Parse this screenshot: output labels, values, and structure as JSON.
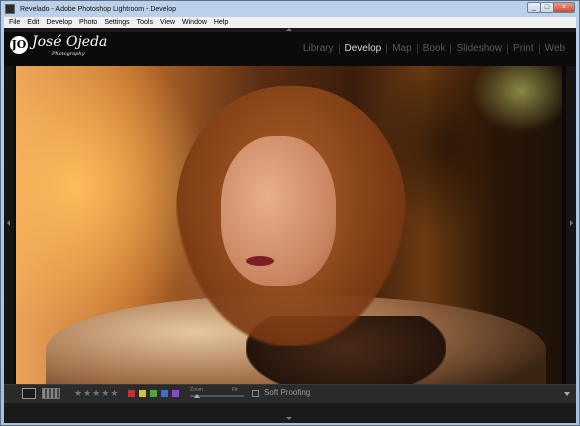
{
  "window": {
    "title": "Revelado - Adobe Photoshop Lightroom - Develop",
    "buttons": [
      "_",
      "□",
      "×"
    ]
  },
  "menu": [
    "File",
    "Edit",
    "Develop",
    "Photo",
    "Settings",
    "Tools",
    "View",
    "Window",
    "Help"
  ],
  "identity": {
    "badge": "JO",
    "name": "José Ojeda",
    "subtitle": "Photography"
  },
  "modules": {
    "items": [
      "Library",
      "Develop",
      "Map",
      "Book",
      "Slideshow",
      "Print",
      "Web"
    ],
    "active": "Develop"
  },
  "toolbar": {
    "stars_glyph": "★",
    "zoom_label": "Zoom",
    "fit_label": "Fit",
    "soft_proofing_label": "Soft Proofing",
    "color_labels": [
      "#c8302d",
      "#d6c22e",
      "#4ea83a",
      "#3e6fd0",
      "#8a4ac8"
    ]
  },
  "colors": {
    "active_module": "#d8d8d8",
    "inactive_module": "#5a5a5a",
    "panel_bg": "#2b2b2b"
  }
}
